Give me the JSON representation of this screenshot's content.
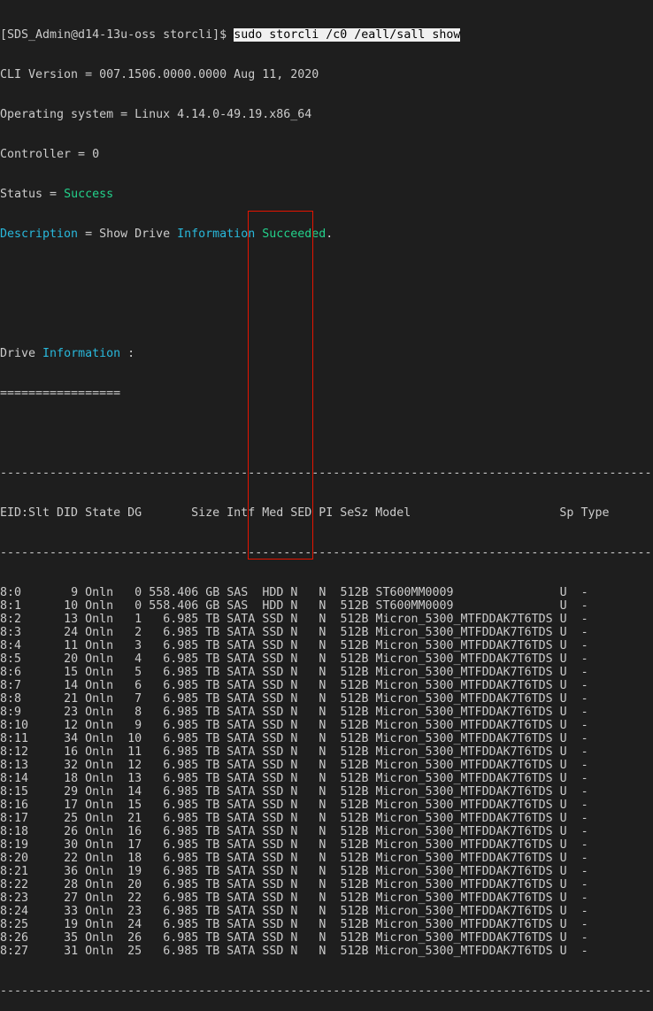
{
  "colors": {
    "background": "#1e1e1e",
    "text": "#cccccc",
    "green": "#23d18b",
    "blue": "#29b8db",
    "highlight_box": "#e51400"
  },
  "prompt": "[SDS_Admin@d14-13u-oss storcli]$ ",
  "command": "sudo storcli /c0 /eall/sall show",
  "cli_version": "CLI Version = 007.1506.0000.0000 Aug 11, 2020",
  "os": "Operating system = Linux 4.14.0-49.19.x86_64",
  "controller": "Controller = 0",
  "status": {
    "label": "Status = ",
    "value": "Success"
  },
  "description": {
    "label": "Description",
    "sep": " = Show Drive ",
    "info": "Information",
    "space": " ",
    "result": "Succeeded",
    "end": "."
  },
  "section": {
    "prefix": "Drive ",
    "info": "Information",
    "suffix": " :",
    "underline": "================="
  },
  "rule": "--------------------------------------------------------------------------------------------",
  "table": {
    "header": "EID:Slt DID State DG       Size Intf Med SED PI SeSz Model                     Sp Type",
    "rows": [
      [
        "8:0",
        "9",
        "Onln",
        "0",
        "558.406 GB",
        "SAS",
        "HDD",
        "N",
        "N",
        "512B",
        "ST600MM0009",
        "U",
        "-"
      ],
      [
        "8:1",
        "10",
        "Onln",
        "0",
        "558.406 GB",
        "SAS",
        "HDD",
        "N",
        "N",
        "512B",
        "ST600MM0009",
        "U",
        "-"
      ],
      [
        "8:2",
        "13",
        "Onln",
        "1",
        "6.985 TB",
        "SATA",
        "SSD",
        "N",
        "N",
        "512B",
        "Micron_5300_MTFDDAK7T6TDS",
        "U",
        "-"
      ],
      [
        "8:3",
        "24",
        "Onln",
        "2",
        "6.985 TB",
        "SATA",
        "SSD",
        "N",
        "N",
        "512B",
        "Micron_5300_MTFDDAK7T6TDS",
        "U",
        "-"
      ],
      [
        "8:4",
        "11",
        "Onln",
        "3",
        "6.985 TB",
        "SATA",
        "SSD",
        "N",
        "N",
        "512B",
        "Micron_5300_MTFDDAK7T6TDS",
        "U",
        "-"
      ],
      [
        "8:5",
        "20",
        "Onln",
        "4",
        "6.985 TB",
        "SATA",
        "SSD",
        "N",
        "N",
        "512B",
        "Micron_5300_MTFDDAK7T6TDS",
        "U",
        "-"
      ],
      [
        "8:6",
        "15",
        "Onln",
        "5",
        "6.985 TB",
        "SATA",
        "SSD",
        "N",
        "N",
        "512B",
        "Micron_5300_MTFDDAK7T6TDS",
        "U",
        "-"
      ],
      [
        "8:7",
        "14",
        "Onln",
        "6",
        "6.985 TB",
        "SATA",
        "SSD",
        "N",
        "N",
        "512B",
        "Micron_5300_MTFDDAK7T6TDS",
        "U",
        "-"
      ],
      [
        "8:8",
        "21",
        "Onln",
        "7",
        "6.985 TB",
        "SATA",
        "SSD",
        "N",
        "N",
        "512B",
        "Micron_5300_MTFDDAK7T6TDS",
        "U",
        "-"
      ],
      [
        "8:9",
        "23",
        "Onln",
        "8",
        "6.985 TB",
        "SATA",
        "SSD",
        "N",
        "N",
        "512B",
        "Micron_5300_MTFDDAK7T6TDS",
        "U",
        "-"
      ],
      [
        "8:10",
        "12",
        "Onln",
        "9",
        "6.985 TB",
        "SATA",
        "SSD",
        "N",
        "N",
        "512B",
        "Micron_5300_MTFDDAK7T6TDS",
        "U",
        "-"
      ],
      [
        "8:11",
        "34",
        "Onln",
        "10",
        "6.985 TB",
        "SATA",
        "SSD",
        "N",
        "N",
        "512B",
        "Micron_5300_MTFDDAK7T6TDS",
        "U",
        "-"
      ],
      [
        "8:12",
        "16",
        "Onln",
        "11",
        "6.985 TB",
        "SATA",
        "SSD",
        "N",
        "N",
        "512B",
        "Micron_5300_MTFDDAK7T6TDS",
        "U",
        "-"
      ],
      [
        "8:13",
        "32",
        "Onln",
        "12",
        "6.985 TB",
        "SATA",
        "SSD",
        "N",
        "N",
        "512B",
        "Micron_5300_MTFDDAK7T6TDS",
        "U",
        "-"
      ],
      [
        "8:14",
        "18",
        "Onln",
        "13",
        "6.985 TB",
        "SATA",
        "SSD",
        "N",
        "N",
        "512B",
        "Micron_5300_MTFDDAK7T6TDS",
        "U",
        "-"
      ],
      [
        "8:15",
        "29",
        "Onln",
        "14",
        "6.985 TB",
        "SATA",
        "SSD",
        "N",
        "N",
        "512B",
        "Micron_5300_MTFDDAK7T6TDS",
        "U",
        "-"
      ],
      [
        "8:16",
        "17",
        "Onln",
        "15",
        "6.985 TB",
        "SATA",
        "SSD",
        "N",
        "N",
        "512B",
        "Micron_5300_MTFDDAK7T6TDS",
        "U",
        "-"
      ],
      [
        "8:17",
        "25",
        "Onln",
        "21",
        "6.985 TB",
        "SATA",
        "SSD",
        "N",
        "N",
        "512B",
        "Micron_5300_MTFDDAK7T6TDS",
        "U",
        "-"
      ],
      [
        "8:18",
        "26",
        "Onln",
        "16",
        "6.985 TB",
        "SATA",
        "SSD",
        "N",
        "N",
        "512B",
        "Micron_5300_MTFDDAK7T6TDS",
        "U",
        "-"
      ],
      [
        "8:19",
        "30",
        "Onln",
        "17",
        "6.985 TB",
        "SATA",
        "SSD",
        "N",
        "N",
        "512B",
        "Micron_5300_MTFDDAK7T6TDS",
        "U",
        "-"
      ],
      [
        "8:20",
        "22",
        "Onln",
        "18",
        "6.985 TB",
        "SATA",
        "SSD",
        "N",
        "N",
        "512B",
        "Micron_5300_MTFDDAK7T6TDS",
        "U",
        "-"
      ],
      [
        "8:21",
        "36",
        "Onln",
        "19",
        "6.985 TB",
        "SATA",
        "SSD",
        "N",
        "N",
        "512B",
        "Micron_5300_MTFDDAK7T6TDS",
        "U",
        "-"
      ],
      [
        "8:22",
        "28",
        "Onln",
        "20",
        "6.985 TB",
        "SATA",
        "SSD",
        "N",
        "N",
        "512B",
        "Micron_5300_MTFDDAK7T6TDS",
        "U",
        "-"
      ],
      [
        "8:23",
        "27",
        "Onln",
        "22",
        "6.985 TB",
        "SATA",
        "SSD",
        "N",
        "N",
        "512B",
        "Micron_5300_MTFDDAK7T6TDS",
        "U",
        "-"
      ],
      [
        "8:24",
        "33",
        "Onln",
        "23",
        "6.985 TB",
        "SATA",
        "SSD",
        "N",
        "N",
        "512B",
        "Micron_5300_MTFDDAK7T6TDS",
        "U",
        "-"
      ],
      [
        "8:25",
        "19",
        "Onln",
        "24",
        "6.985 TB",
        "SATA",
        "SSD",
        "N",
        "N",
        "512B",
        "Micron_5300_MTFDDAK7T6TDS",
        "U",
        "-"
      ],
      [
        "8:26",
        "35",
        "Onln",
        "26",
        "6.985 TB",
        "SATA",
        "SSD",
        "N",
        "N",
        "512B",
        "Micron_5300_MTFDDAK7T6TDS",
        "U",
        "-"
      ],
      [
        "8:27",
        "31",
        "Onln",
        "25",
        "6.985 TB",
        "SATA",
        "SSD",
        "N",
        "N",
        "512B",
        "Micron_5300_MTFDDAK7T6TDS",
        "U",
        "-"
      ]
    ]
  }
}
